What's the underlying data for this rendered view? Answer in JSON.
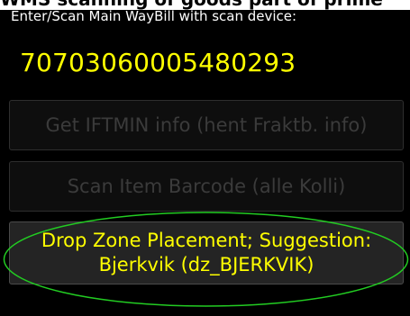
{
  "header": {
    "title": "WMS scanning of goods part of prime"
  },
  "waybill": {
    "prompt": "Enter/Scan Main WayBill with scan device:",
    "value": "70703060005480293"
  },
  "buttons": {
    "iftmin_label": "Get IFTMIN info (hent Fraktb. info)",
    "scan_item_label": "Scan Item Barcode (alle Kolli)",
    "drop_zone_line1": "Drop Zone Placement; Suggestion:",
    "drop_zone_line2": "Bjerkvik (dz_BJERKVIK)"
  },
  "colors": {
    "background": "#000000",
    "value_text": "#ffff00",
    "disabled_text": "#3b3b3b",
    "highlight_ellipse": "#22cc22"
  }
}
